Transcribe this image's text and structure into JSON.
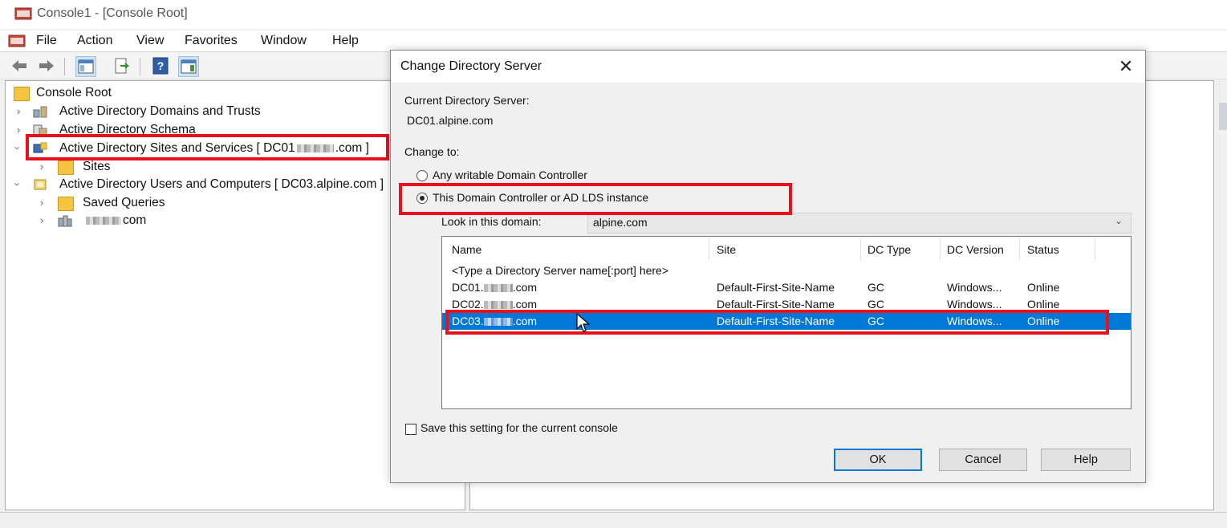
{
  "window": {
    "title": "Console1 - [Console Root]",
    "menu": [
      "File",
      "Action",
      "View",
      "Favorites",
      "Window",
      "Help"
    ]
  },
  "tree": {
    "root": "Console Root",
    "items": [
      {
        "label": "Active Directory Domains and Trusts",
        "level": 1,
        "expanded": false
      },
      {
        "label": "Active Directory Schema",
        "level": 1,
        "expanded": false
      },
      {
        "label": "Active Directory Sites and Services [ DC01",
        "label_tail": ".com ]",
        "level": 1,
        "expanded": true
      },
      {
        "label": "Sites",
        "level": 2,
        "expanded": false
      },
      {
        "label": "Active Directory Users and Computers [ DC03.alpine.com ]",
        "level": 1,
        "expanded": true
      },
      {
        "label": "Saved Queries",
        "level": 2,
        "expanded": false
      },
      {
        "label": "com",
        "level": 2,
        "expanded": false
      }
    ]
  },
  "dialog": {
    "title": "Change Directory Server",
    "close_label": "✕",
    "current_label": "Current Directory Server:",
    "current_value": "DC01.alpine.com",
    "change_to_label": "Change to:",
    "option_any": "Any writable Domain Controller",
    "option_this": "This Domain Controller or AD LDS instance",
    "selected_option": "this",
    "look_in_label": "Look in this domain:",
    "look_in_value": "alpine.com",
    "columns": [
      "Name",
      "Site",
      "DC Type",
      "DC Version",
      "Status"
    ],
    "placeholder_row": "<Type a Directory Server name[:port] here>",
    "rows": [
      {
        "name_prefix": "DC01.",
        "name_suffix": ".com",
        "site": "Default-First-Site-Name",
        "type": "GC",
        "version": "Windows...",
        "status": "Online",
        "selected": false
      },
      {
        "name_prefix": "DC02.",
        "name_suffix": ".com",
        "site": "Default-First-Site-Name",
        "type": "GC",
        "version": "Windows...",
        "status": "Online",
        "selected": false
      },
      {
        "name_prefix": "DC03.",
        "name_suffix": ".com",
        "site": "Default-First-Site-Name",
        "type": "GC",
        "version": "Windows...",
        "status": "Online",
        "selected": true
      }
    ],
    "save_setting_label": "Save this setting for the current console",
    "ok_label": "OK",
    "cancel_label": "Cancel",
    "help_label": "Help"
  },
  "colors": {
    "highlight": "#e8101c",
    "selection": "#0078d7"
  }
}
